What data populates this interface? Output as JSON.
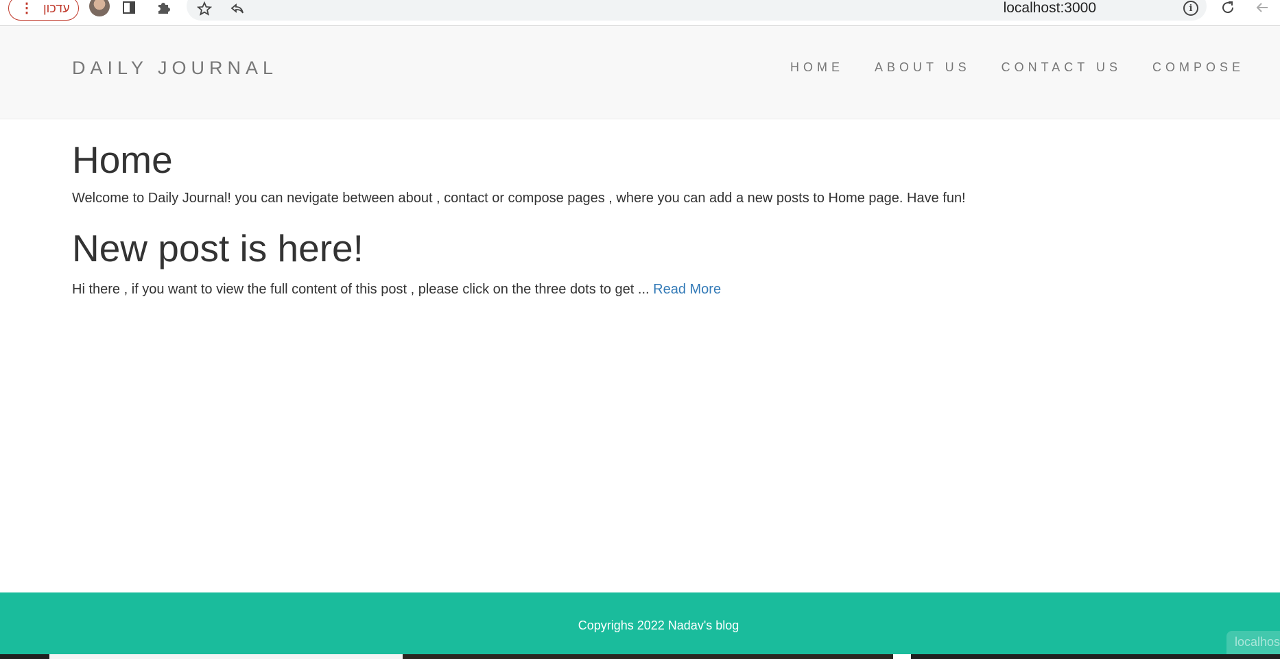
{
  "browser": {
    "update_label": "עדכון",
    "url": "localhost:3000",
    "icons": [
      "menu-dots-icon",
      "profile-avatar",
      "side-panel-icon",
      "extensions-puzzle-icon",
      "bookmark-star-icon",
      "share-icon",
      "site-info-icon",
      "reload-icon",
      "back-arrow-icon"
    ]
  },
  "site": {
    "brand": "DAILY JOURNAL",
    "nav": [
      {
        "label": "HOME"
      },
      {
        "label": "ABOUT US"
      },
      {
        "label": "CONTACT US"
      },
      {
        "label": "COMPOSE"
      }
    ]
  },
  "main": {
    "title": "Home",
    "intro": "Welcome to Daily Journal! you can nevigate between about , contact or compose pages , where you can add a new posts to Home page. Have fun!",
    "posts": [
      {
        "title": "New post is here!",
        "excerpt": "Hi there , if you want to view the full content of this post , please click on the three dots to get ...",
        "link_label": "Read More"
      }
    ]
  },
  "footer": {
    "text": "Copyrighs 2022 Nadav's blog",
    "tooltip_peek": "localhost"
  },
  "colors": {
    "footer_bg": "#1abc9c",
    "header_bg": "#f8f8f8",
    "link": "#337ab7",
    "update_accent": "#c0392b"
  }
}
